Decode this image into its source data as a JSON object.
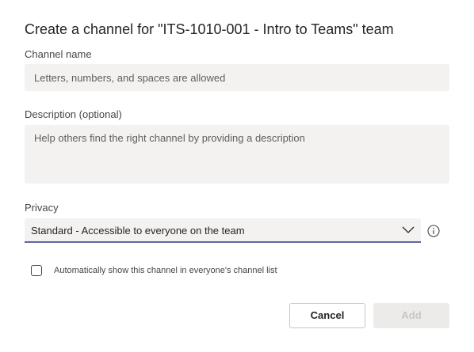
{
  "dialog": {
    "title": "Create a channel for \"ITS-1010-001 - Intro to Teams\" team"
  },
  "channel_name": {
    "label": "Channel name",
    "value": "",
    "placeholder": "Letters, numbers, and spaces are allowed"
  },
  "description": {
    "label": "Description (optional)",
    "value": "",
    "placeholder": "Help others find the right channel by providing a description"
  },
  "privacy": {
    "label": "Privacy",
    "selected": "Standard - Accessible to everyone on the team",
    "icon": "chevron-down-icon",
    "info_icon": "info-icon"
  },
  "auto_show": {
    "label": "Automatically show this channel in everyone's channel list",
    "checked": false
  },
  "buttons": {
    "cancel": "Cancel",
    "add": "Add"
  },
  "colors": {
    "accent": "#6264a7",
    "field_bg": "#f3f2f1",
    "disabled_bg": "#edebe9",
    "disabled_text": "#c8c6c4"
  }
}
